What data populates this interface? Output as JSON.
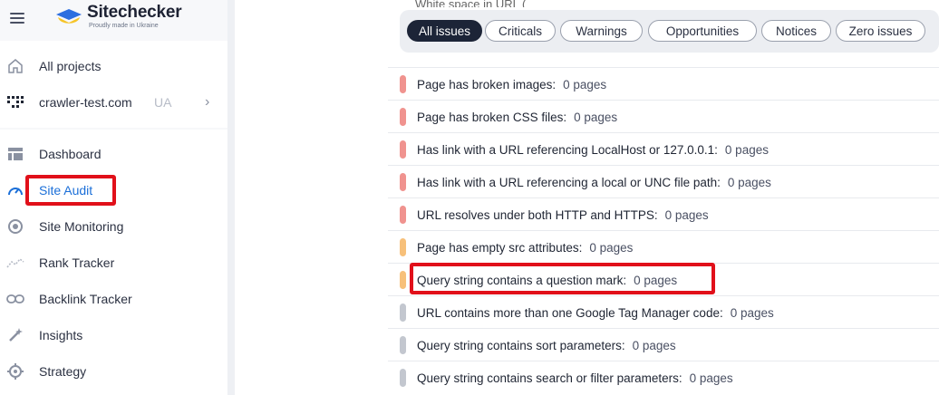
{
  "brand": {
    "title": "Sitechecker",
    "subtitle": "Proudly made in Ukraine"
  },
  "project_nav": [
    {
      "label": "All projects",
      "icon": "home-icon"
    },
    {
      "label": "crawler-test.com",
      "badge": "UA",
      "icon": "project-grid-icon"
    }
  ],
  "nav": [
    {
      "label": "Dashboard",
      "icon": "dashboard-icon",
      "active": false
    },
    {
      "label": "Site Audit",
      "icon": "gauge-icon",
      "active": true
    },
    {
      "label": "Site Monitoring",
      "icon": "monitoring-icon",
      "active": false
    },
    {
      "label": "Rank Tracker",
      "icon": "trend-icon",
      "active": false
    },
    {
      "label": "Backlink Tracker",
      "icon": "link-icon",
      "active": false
    },
    {
      "label": "Insights",
      "icon": "magic-wand-icon",
      "active": false
    },
    {
      "label": "Strategy",
      "icon": "target-icon",
      "active": false
    }
  ],
  "filters": [
    {
      "label": "All issues",
      "active": true
    },
    {
      "label": "Criticals",
      "active": false
    },
    {
      "label": "Warnings",
      "active": false
    },
    {
      "label": "Opportunities",
      "active": false
    },
    {
      "label": "Notices",
      "active": false
    },
    {
      "label": "Zero issues",
      "active": false
    }
  ],
  "cut_off_text": "White space in URL (",
  "issues": [
    {
      "label": "Page has broken images:",
      "count": "0 pages",
      "severity": "critical"
    },
    {
      "label": "Page has broken CSS files:",
      "count": "0 pages",
      "severity": "critical"
    },
    {
      "label": "Has link with a URL referencing LocalHost or 127.0.0.1:",
      "count": "0 pages",
      "severity": "critical"
    },
    {
      "label": "Has link with a URL referencing a local or UNC file path:",
      "count": "0 pages",
      "severity": "critical"
    },
    {
      "label": "URL resolves under both HTTP and HTTPS:",
      "count": "0 pages",
      "severity": "critical"
    },
    {
      "label": "Page has empty src attributes:",
      "count": "0 pages",
      "severity": "warning"
    },
    {
      "label": "Query string contains a question mark:",
      "count": "0 pages",
      "severity": "warning"
    },
    {
      "label": "URL contains more than one Google Tag Manager code:",
      "count": "0 pages",
      "severity": "notice"
    },
    {
      "label": "Query string contains sort parameters:",
      "count": "0 pages",
      "severity": "notice"
    },
    {
      "label": "Query string contains search or filter parameters:",
      "count": "0 pages",
      "severity": "notice"
    }
  ],
  "colors": {
    "critical": "#f0938f",
    "warning": "#f7c07a",
    "notice": "#c3c7cf",
    "accent": "#1b6fd8",
    "highlight": "#e1101a"
  }
}
